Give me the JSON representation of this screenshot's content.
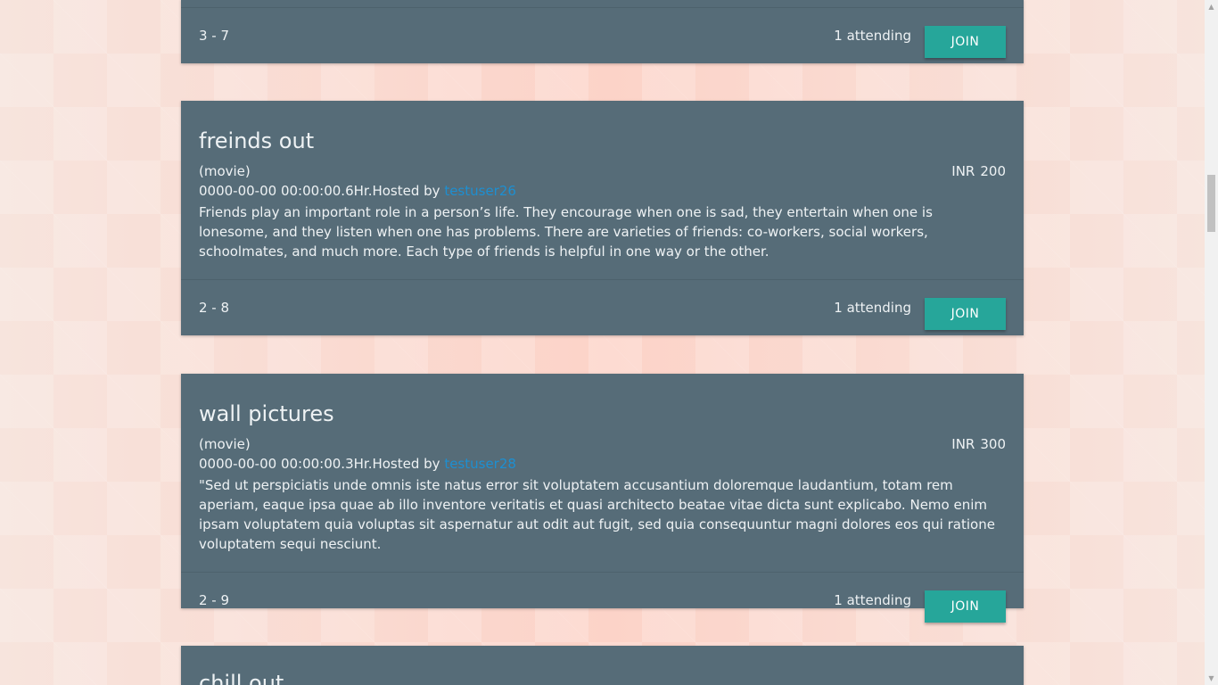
{
  "events": [
    {
      "range": "3 - 7",
      "attending": "1 attending",
      "join_label": "JOIN"
    },
    {
      "title": "freinds out",
      "category": "(movie)",
      "currency": "INR",
      "price": "200",
      "datetime_text": "0000-00-00 00:00:00.6Hr.Hosted by",
      "host": "testuser26",
      "description": "Friends play an important role in a person’s life. They encourage when one is sad, they entertain when one is lonesome, and they listen when one has problems. There are varieties of friends: co-workers, social workers, schoolmates, and much more. Each type of friends is helpful in one way or the other.",
      "range": "2 - 8",
      "attending": "1 attending",
      "join_label": "JOIN"
    },
    {
      "title": "wall pictures",
      "category": "(movie)",
      "currency": "INR",
      "price": "300",
      "datetime_text": "0000-00-00 00:00:00.3Hr.Hosted by",
      "host": "testuser28",
      "description": "\"Sed ut perspiciatis unde omnis iste natus error sit voluptatem accusantium doloremque laudantium, totam rem aperiam, eaque ipsa quae ab illo inventore veritatis et quasi architecto beatae vitae dicta sunt explicabo. Nemo enim ipsam voluptatem quia voluptas sit aspernatur aut odit aut fugit, sed quia consequuntur magni dolores eos qui ratione voluptatem sequi nesciunt.",
      "range": "2 - 9",
      "attending": "1 attending",
      "join_label": "JOIN"
    },
    {
      "title": "chill out"
    }
  ],
  "scrollbar": {
    "up_arrow": "▲",
    "down_arrow": "▼"
  }
}
